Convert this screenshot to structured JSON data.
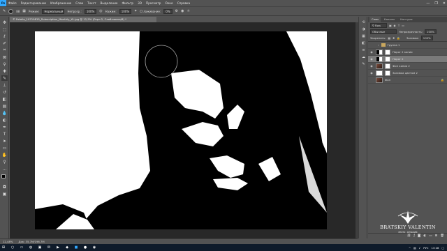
{
  "app": {
    "logo": "Ps"
  },
  "menu": [
    "Файл",
    "Редактирование",
    "Изображение",
    "Слои",
    "Текст",
    "Выделение",
    "Фильтр",
    "3D",
    "Просмотр",
    "Окно",
    "Справка"
  ],
  "window_controls": {
    "minimize": "—",
    "maximize": "❐",
    "close": "✕"
  },
  "options": {
    "brush_size": "88",
    "mode_label": "Режим:",
    "mode_value": "Нормальный",
    "opacity_label": "Непрозр.:",
    "opacity_value": "100%",
    "flow_label": "Нажим:",
    "flow_value": "100%",
    "smoothing_label": "Сглаживание:",
    "smoothing_value": "0%"
  },
  "document": {
    "tab_title": "© Fotolia_10710815_Subscription_Monthly_XL.jpg @ 12,5% (Рорл 2, Слой-маска/8) *",
    "close": "×"
  },
  "status": {
    "zoom": "12,48%",
    "doc_size": "Док: 35,7М/196,7М"
  },
  "panel": {
    "tabs": [
      "Слои",
      "Каналы",
      "Контуры"
    ],
    "active_tab": "Слои",
    "filter_label": "Вид",
    "blend_mode": "Обычные",
    "opacity_label": "Непрозрачность:",
    "opacity_value": "100%",
    "lock_label": "Закрепить:",
    "fill_label": "Заливка:",
    "fill_value": "100%",
    "layers": [
      {
        "name": "Группа 1",
        "kind": "group",
        "selected": false
      },
      {
        "name": "Порог 2 копия",
        "kind": "adjustment",
        "selected": false
      },
      {
        "name": "Порог 2",
        "kind": "adjustment",
        "selected": true
      },
      {
        "name": "Фон копия 2",
        "kind": "photo",
        "selected": false
      },
      {
        "name": "Заливка цветом 2",
        "kind": "fill",
        "selected": false
      },
      {
        "name": "Фон",
        "kind": "photo",
        "selected": false
      }
    ],
    "bottom_icons": [
      "link-icon",
      "fx-icon",
      "mask-icon",
      "adjustment-icon",
      "folder-icon",
      "new-layer-icon",
      "trash-icon"
    ]
  },
  "watermark": {
    "name": "BRATSKIY VALENTIN",
    "subtitle": "PHOTO · DESIGNER"
  },
  "taskbar": {
    "lang": "РУС",
    "time": "13:28"
  },
  "colors": {
    "ps_blue": "#31a8ff",
    "ui_gray": "#535353",
    "canvas_bg": "#282828"
  },
  "tools": [
    "move",
    "marquee",
    "lasso",
    "quick-select",
    "crop",
    "frame",
    "eyedropper",
    "healing",
    "brush",
    "stamp",
    "history-brush",
    "eraser",
    "gradient",
    "blur",
    "dodge",
    "pen",
    "type",
    "path-select",
    "shape",
    "hand",
    "zoom",
    "more",
    "colors"
  ]
}
